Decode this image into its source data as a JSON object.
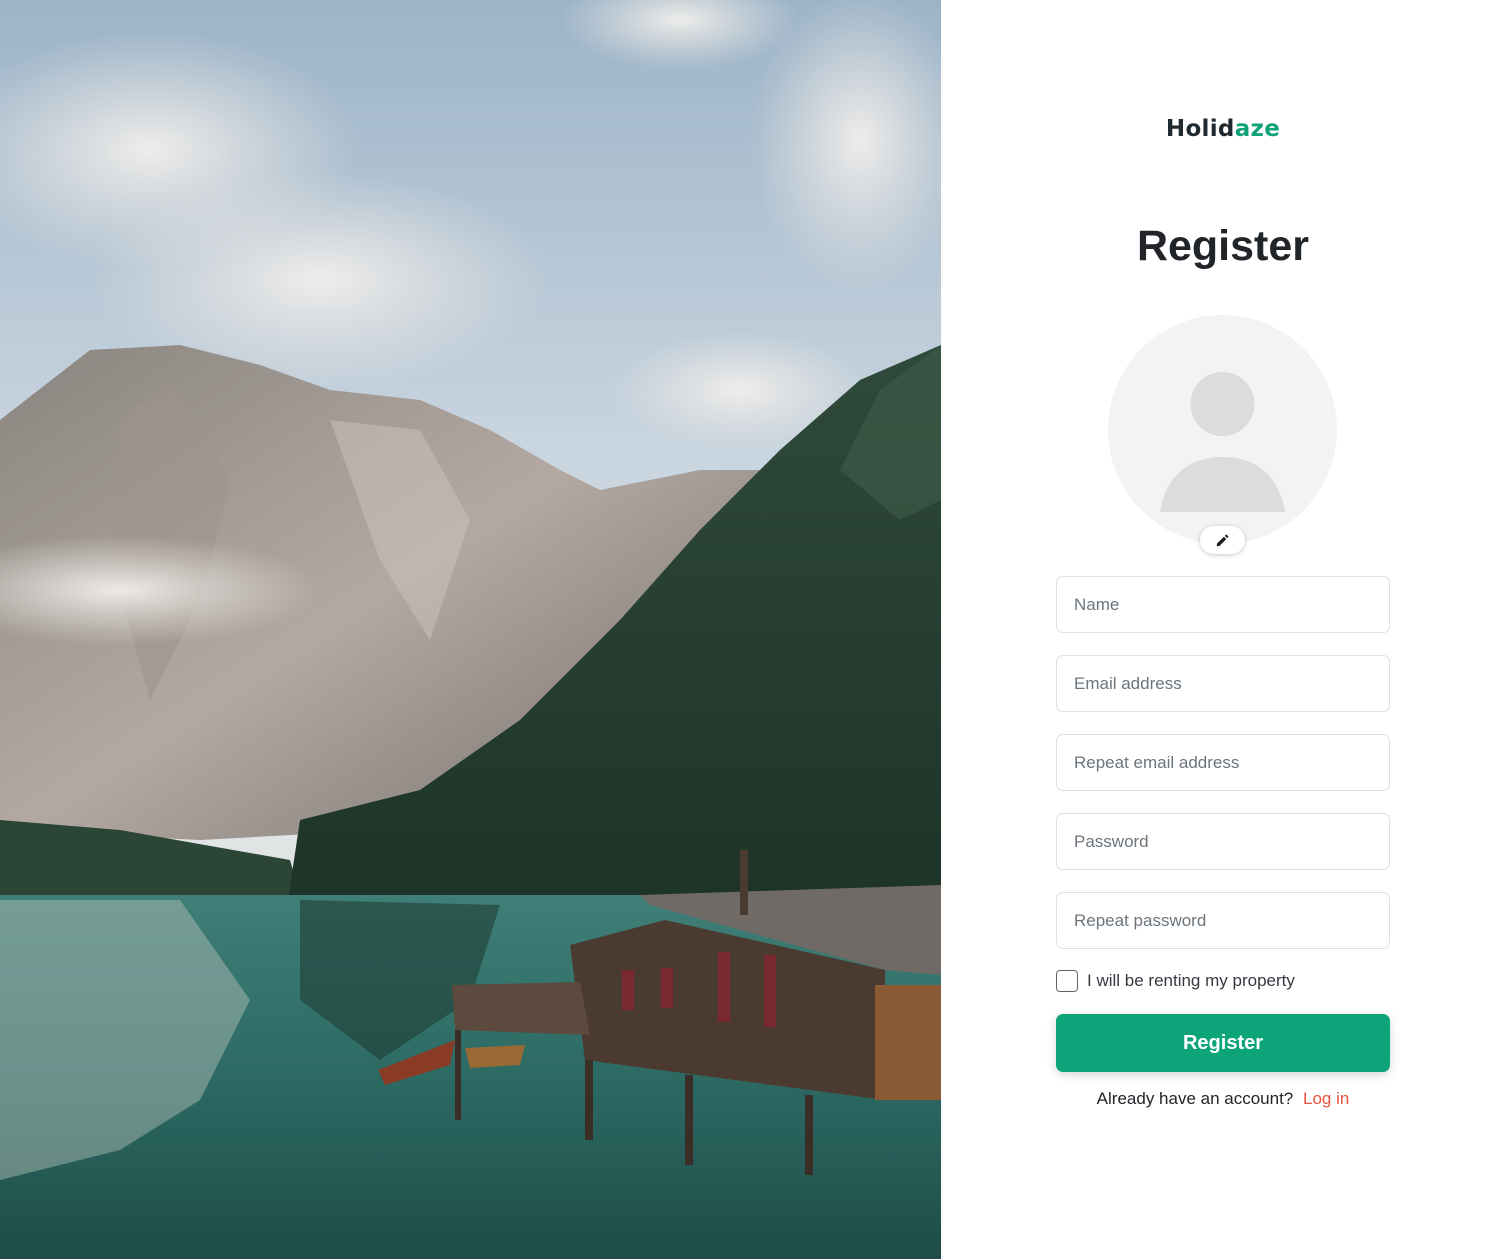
{
  "logo": {
    "part1": "Holid",
    "part2": "aze"
  },
  "page_title": "Register",
  "avatar": {
    "icon": "user-placeholder-icon",
    "edit_icon": "pencil-icon"
  },
  "form": {
    "name_placeholder": "Name",
    "email_placeholder": "Email address",
    "repeat_email_placeholder": "Repeat email address",
    "password_placeholder": "Password",
    "repeat_password_placeholder": "Repeat password",
    "renting_checkbox_label": "I will be renting my property",
    "renting_checked": false,
    "submit_label": "Register"
  },
  "login_prompt": {
    "text": "Already have an account?",
    "link_label": "Log in"
  },
  "colors": {
    "accent": "#0da47a",
    "link": "#e7533d",
    "text": "#212529"
  }
}
